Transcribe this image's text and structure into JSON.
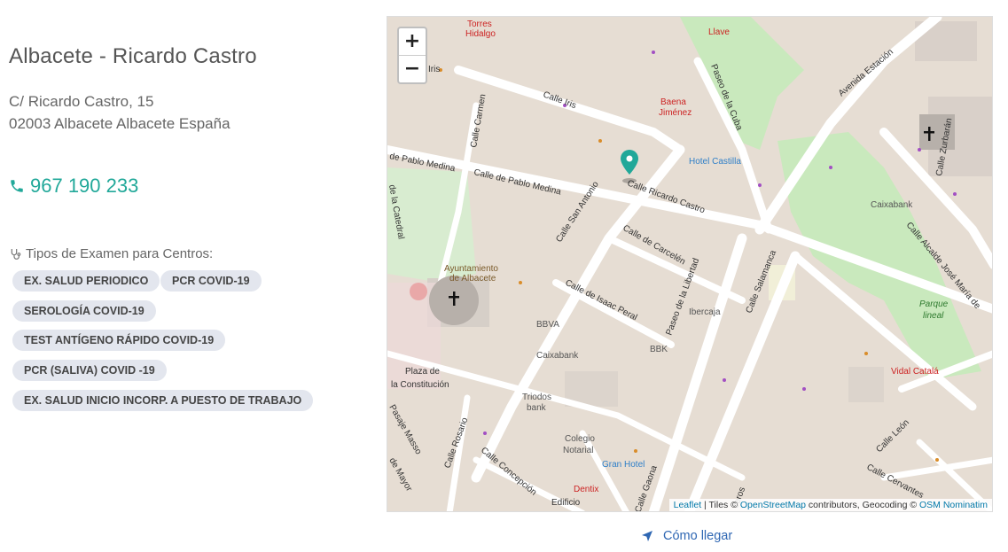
{
  "center": {
    "title": "Albacete - Ricardo Castro",
    "address_line1": "C/ Ricardo Castro, 15",
    "address_line2": "02003 Albacete Albacete España",
    "phone": "967 190 233",
    "exam_types_label": "Tipos de Examen para Centros:"
  },
  "exam_types": [
    "EX. SALUD PERIODICO",
    "PCR COVID-19",
    "SEROLOGÍA COVID-19",
    "TEST ANTÍGENO RÁPIDO COVID-19",
    "PCR (SALIVA) COVID -19",
    "EX. SALUD INICIO  INCORP. A PUESTO DE TRABAJO"
  ],
  "map": {
    "zoom_in": "+",
    "zoom_out": "−",
    "attribution": {
      "leaflet": "Leaflet",
      "tiles_text": " | Tiles © ",
      "osm": "OpenStreetMap",
      "contrib_text": " contributors, Geocoding © ",
      "nominatim": "OSM Nominatim"
    },
    "labels": {
      "torres_hidalgo_1": "Torres",
      "torres_hidalgo_2": "Hidalgo",
      "iris": "Iris",
      "calle_iris": "Calle Iris",
      "calle_carmen": "Calle Carmen",
      "calle_pablo_medina_1": "de Pablo Medina",
      "calle_pablo_medina_2": "Calle de Pablo Medina",
      "calle_ricardo_castro": "Calle Ricardo Castro",
      "calle_san_antonio": "Calle San Antonio",
      "calle_carcelen": "Calle de Carcelén",
      "calle_isaac_peral": "Calle de Isaac Peral",
      "paseo_libertad": "Paseo de la Libertad",
      "calle_salamanca": "Calle Salamanca",
      "paseo_cuba": "Paseo de la Cuba",
      "avenida_estacion": "Avenida Estación",
      "calle_zurbaran": "Calle Zurbarán",
      "calle_alcalde": "Calle Alcalde José María de",
      "baena_1": "Baena",
      "baena_2": "Jiménez",
      "hotel_castilla": "Hotel Castilla",
      "llave": "Llave",
      "caixabank_1": "Caixabank",
      "caixabank_2": "Caixabank",
      "parque_1": "Parque",
      "parque_2": "lineal",
      "ayto_1": "Ayuntamiento",
      "ayto_2": "de Albacete",
      "bbva": "BBVA",
      "bbk": "BBK",
      "ibercaja": "Ibercaja",
      "vidal": "Vidal Catalá",
      "plaza_1": "Plaza de",
      "plaza_2": "la Constitución",
      "triodos_1": "Triodos",
      "triodos_2": "bank",
      "colegio_1": "Colegio",
      "colegio_2": "Notarial",
      "gran_hotel": "Gran Hotel",
      "dentix": "Dentix",
      "edificio": "Edificio",
      "calle_rosario": "Calle Rosario",
      "calle_concepcion": "Calle Concepción",
      "pasaje_masso": "Pasaje Masso",
      "calle_mayor": "de Mayor",
      "calle_leon": "Calle León",
      "calle_cervantes": "Calle Cervantes",
      "calle_gaona": "Calle Gaona",
      "calle_catedral": "de la Catedral",
      "cereros": "ceros"
    }
  },
  "directions": {
    "label": "Cómo llegar"
  },
  "colors": {
    "teal": "#21a899",
    "chip_bg": "#e3e6ee",
    "link": "#2f67b3"
  }
}
